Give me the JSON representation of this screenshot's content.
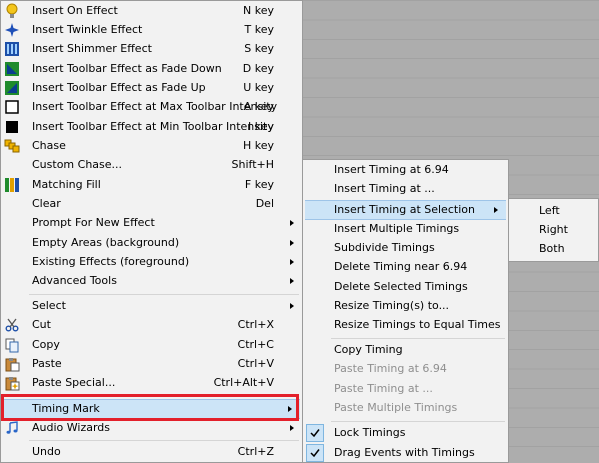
{
  "main_menu": {
    "items": [
      {
        "label": "Insert On Effect",
        "key": "N key",
        "icon": "bulb-icon"
      },
      {
        "label": "Insert Twinkle Effect",
        "key": "T key",
        "icon": "twinkle-icon"
      },
      {
        "label": "Insert Shimmer Effect",
        "key": "S key",
        "icon": "shimmer-icon"
      },
      {
        "label": "Insert Toolbar Effect as Fade Down",
        "key": "D key",
        "icon": "fade-down-icon"
      },
      {
        "label": "Insert Toolbar Effect as Fade Up",
        "key": "U key",
        "icon": "fade-up-icon"
      },
      {
        "label": "Insert Toolbar Effect at Max Toolbar Intensity",
        "key": "A key",
        "icon": "max-intensity-icon"
      },
      {
        "label": "Insert Toolbar Effect at Min Toolbar Intensity",
        "key": "I key",
        "icon": "min-intensity-icon"
      },
      {
        "label": "Chase",
        "key": "H key",
        "icon": "chase-icon"
      },
      {
        "label": "Custom Chase...",
        "key": "Shift+H",
        "icon": ""
      },
      {
        "label": "Matching Fill",
        "key": "F key",
        "icon": "matching-fill-icon"
      },
      {
        "label": "Clear",
        "key": "Del",
        "icon": ""
      },
      {
        "label": "Prompt For New Effect",
        "key": "",
        "icon": "",
        "submenu": true
      },
      {
        "label": "Empty Areas (background)",
        "key": "",
        "icon": "",
        "submenu": true
      },
      {
        "label": "Existing Effects (foreground)",
        "key": "",
        "icon": "",
        "submenu": true
      },
      {
        "label": "Advanced Tools",
        "key": "",
        "icon": "",
        "submenu": true
      },
      {
        "label": "Select",
        "key": "",
        "icon": "",
        "submenu": true
      },
      {
        "label": "Cut",
        "key": "Ctrl+X",
        "icon": "scissors-icon"
      },
      {
        "label": "Copy",
        "key": "Ctrl+C",
        "icon": "copy-icon"
      },
      {
        "label": "Paste",
        "key": "Ctrl+V",
        "icon": "paste-icon"
      },
      {
        "label": "Paste Special...",
        "key": "Ctrl+Alt+V",
        "icon": "paste-special-icon"
      },
      {
        "label": "Timing Mark",
        "key": "",
        "icon": "",
        "submenu": true
      },
      {
        "label": "Audio Wizards",
        "key": "",
        "icon": "music-note-icon",
        "submenu": true
      },
      {
        "label": "Undo",
        "key": "Ctrl+Z",
        "icon": ""
      }
    ]
  },
  "timing_menu": {
    "items": [
      {
        "label": "Insert Timing at 6.94"
      },
      {
        "label": "Insert Timing at ..."
      },
      {
        "label": "Insert Timing at Selection",
        "submenu": true
      },
      {
        "label": "Insert Multiple Timings"
      },
      {
        "label": "Subdivide Timings"
      },
      {
        "label": "Delete Timing near 6.94"
      },
      {
        "label": "Delete Selected Timings"
      },
      {
        "label": "Resize Timing(s) to..."
      },
      {
        "label": "Resize Timings to Equal Times"
      },
      {
        "label": "Copy Timing"
      },
      {
        "label": "Paste Timing at 6.94",
        "disabled": true
      },
      {
        "label": "Paste Timing at ...",
        "disabled": true
      },
      {
        "label": "Paste Multiple Timings",
        "disabled": true
      },
      {
        "label": "Lock Timings",
        "checked": true
      },
      {
        "label": "Drag Events with Timings",
        "checked": true
      }
    ]
  },
  "selection_menu": {
    "items": [
      {
        "label": "Left"
      },
      {
        "label": "Right"
      },
      {
        "label": "Both"
      }
    ]
  },
  "colors": {
    "highlight": "#cce4f7",
    "annotation_box": "#e3202b"
  }
}
